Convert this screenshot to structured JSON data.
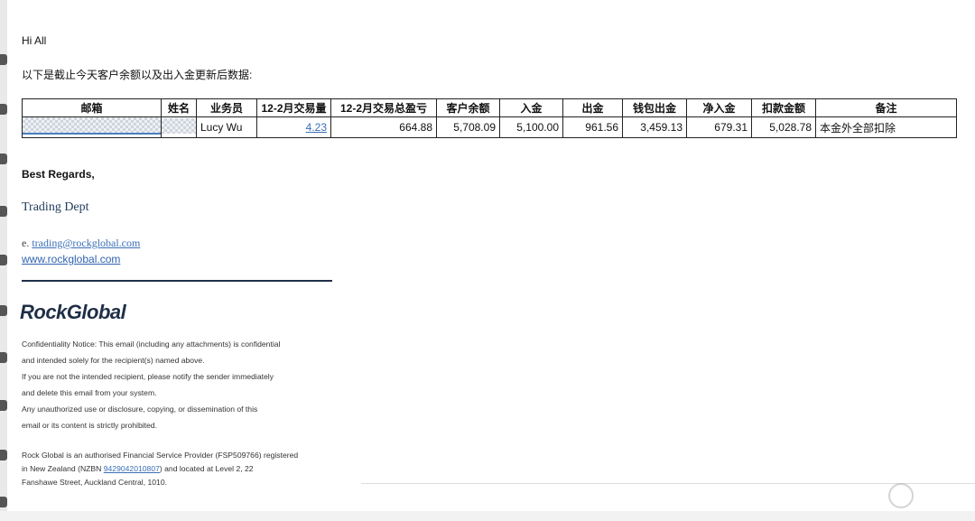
{
  "email": {
    "greeting": "Hi All",
    "intro": "以下是截止今天客户余额以及出入金更新后数据:"
  },
  "table": {
    "headers": [
      "邮箱",
      "姓名",
      "业务员",
      "12-2月交易量",
      "12-2月交易总盈亏",
      "客户余额",
      "入金",
      "出金",
      "钱包出金",
      "净入金",
      "扣款金额",
      "备注"
    ],
    "row": {
      "salesperson": "Lucy Wu",
      "volume": "4.23",
      "total_pnl": "664.88",
      "balance": "5,708.09",
      "deposit": "5,100.00",
      "withdrawal": "961.56",
      "wallet_withdrawal": "3,459.13",
      "net_deposit": "679.31",
      "deduction": "5,028.78",
      "remark": "本金外全部扣除"
    }
  },
  "signature": {
    "regards": "Best Regards,",
    "dept": "Trading Dept",
    "email_prefix": "e. ",
    "email_address": "trading@rockglobal.com",
    "website": "www.rockglobal.com",
    "logo": "RockGlobal"
  },
  "notice": {
    "lines": [
      "Confidentiality Notice: This email (including any attachments) is confidential",
      "and intended solely for the recipient(s) named above.",
      "If you are not the intended recipient, please notify the sender immediately",
      "and delete this email from your system.",
      "Any unauthorized use or disclosure, copying, or dissemination of this",
      "email or its content is strictly prohibited."
    ],
    "legal_line1": "Rock Global is an authorised Financial Service Provider (FSP509766) registered",
    "legal_line2_prefix": "in New Zealand (NZBN ",
    "nzbn": "9429042010807",
    "legal_line2_suffix": ") and located at Level 2, 22",
    "legal_line3": "Fanshawe Street, Auckland Central, 1010."
  },
  "colors": {
    "brand_navy": "#1f2f47",
    "link_blue": "#3a6fb7"
  }
}
